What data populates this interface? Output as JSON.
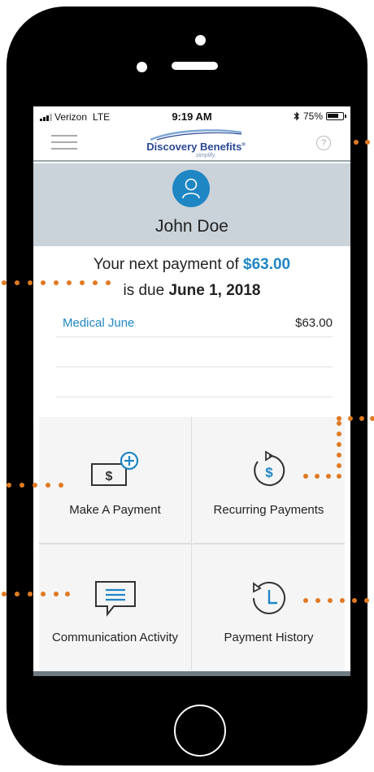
{
  "status_bar": {
    "carrier": "Verizon",
    "network": "LTE",
    "time": "9:19 AM",
    "bluetooth_icon": "bluetooth-icon",
    "battery": "75%"
  },
  "nav": {
    "menu_icon": "hamburger-menu-icon",
    "logo_text": "Discovery Benefits",
    "logo_registered": "®",
    "logo_tagline": "simplify.",
    "help_icon": "?"
  },
  "profile": {
    "name": "John Doe"
  },
  "payment": {
    "prefix": "Your next payment of ",
    "amount": "$63.00",
    "due_prefix": "is due ",
    "due_date": "June 1, 2018"
  },
  "plans": [
    {
      "name": "Medical June",
      "amount": "$63.00"
    }
  ],
  "tiles": [
    {
      "label": "Make A Payment",
      "icon": "payment-add-icon"
    },
    {
      "label": "Recurring Payments",
      "icon": "recurring-payment-icon"
    },
    {
      "label": "Communication Activity",
      "icon": "chat-bubble-icon"
    },
    {
      "label": "Payment History",
      "icon": "history-clock-icon"
    }
  ],
  "colors": {
    "accent": "#1f86c4",
    "brand": "#2b4a93",
    "callout": "#e07a22",
    "profile_bg": "#cad3d9"
  }
}
